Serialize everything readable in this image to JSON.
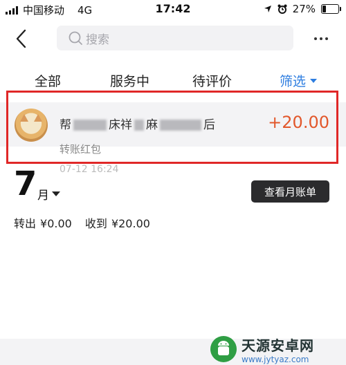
{
  "status_bar": {
    "carrier": "中国移动",
    "network": "4G",
    "time": "17:42",
    "battery_text": "27%",
    "battery_level": 0.27
  },
  "nav": {
    "back_icon": "chevron-left-icon",
    "search_placeholder": "搜索",
    "more_icon": "more-dots-icon"
  },
  "tabs": [
    {
      "label": "全部"
    },
    {
      "label": "服务中"
    },
    {
      "label": "待评价"
    },
    {
      "label": "筛选"
    }
  ],
  "month_section": {
    "month": "7",
    "month_unit": "月",
    "bill_button": "查看月账单",
    "out_label": "转出",
    "out_amount": "¥0.00",
    "in_label": "收到",
    "in_amount": "¥20.00"
  },
  "transaction": {
    "title_head": "帮",
    "title_mid1": "床",
    "title_mid2": "祥",
    "title_mid3": "麻",
    "title_tail": "后",
    "amount": "+20.00",
    "subtitle": "转账红包",
    "time": "07-12  16:24"
  },
  "watermark": {
    "name": "天源安卓网",
    "url": "www.jytyaz.com"
  },
  "colors": {
    "accent": "#2d7de0",
    "amount": "#e2572b",
    "highlight_border": "#e02727",
    "button_bg": "#2b2b2d"
  }
}
